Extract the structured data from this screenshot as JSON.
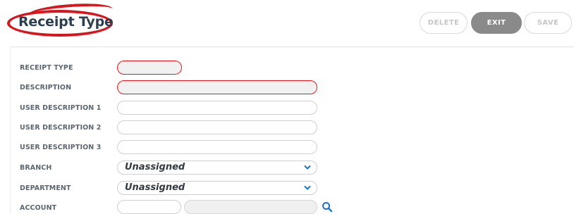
{
  "header": {
    "title": "Receipt Type",
    "buttons": {
      "delete": "DELETE",
      "exit": "EXIT",
      "save": "SAVE"
    }
  },
  "form": {
    "receipt_type": {
      "label": "RECEIPT TYPE",
      "value": ""
    },
    "description": {
      "label": "DESCRIPTION",
      "value": ""
    },
    "user_description_1": {
      "label": "USER DESCRIPTION 1",
      "value": ""
    },
    "user_description_2": {
      "label": "USER DESCRIPTION 2",
      "value": ""
    },
    "user_description_3": {
      "label": "USER DESCRIPTION 3",
      "value": ""
    },
    "branch": {
      "label": "BRANCH",
      "selected": "Unassigned"
    },
    "department": {
      "label": "DEPARTMENT",
      "selected": "Unassigned"
    },
    "account": {
      "label": "ACCOUNT",
      "code": "",
      "name": ""
    }
  },
  "icons": {
    "search": "search-icon",
    "select_chevron": "chevron-down-icon"
  },
  "colors": {
    "required_border": "#e8191f",
    "title_highlight": "#d9141b",
    "accent": "#1a73c8",
    "exit_button": "#8a8a8a"
  }
}
